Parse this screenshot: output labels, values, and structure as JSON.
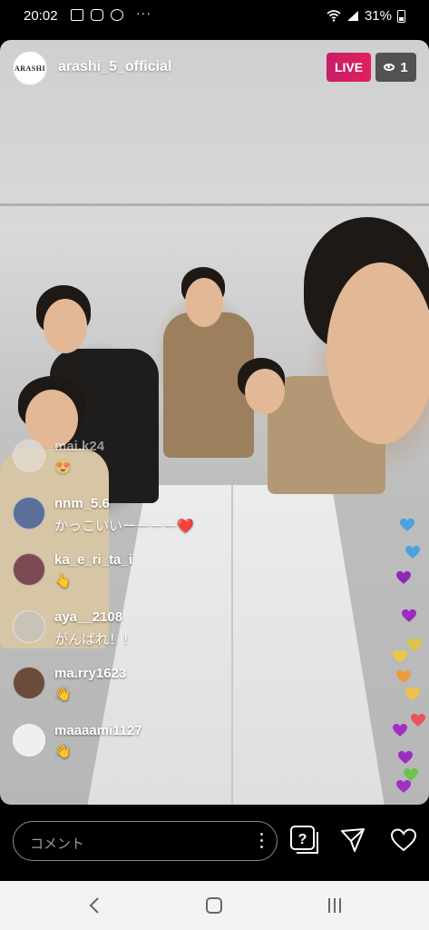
{
  "status_bar": {
    "time": "20:02",
    "battery": "31%",
    "icons": [
      "gallery-icon",
      "line-icon",
      "app-icon",
      "more-dots-icon",
      "wifi-icon",
      "signal-icon",
      "battery-icon"
    ]
  },
  "header": {
    "host_avatar_text": "ARASHI",
    "host_name": "arashi_5_official",
    "live_label": "LIVE",
    "viewer_count": "1"
  },
  "comments": [
    {
      "user": "mai.k24",
      "text": "😍",
      "avatar_color": "#e9e4df"
    },
    {
      "user": "nnm_5.6",
      "text": "かっこいいーーーー❤️",
      "avatar_color": "#5a6f9a"
    },
    {
      "user": "ka_e_ri_ta_i",
      "text": "👆",
      "avatar_color": "#7b4a52"
    },
    {
      "user": "aya__2108",
      "text": "がんばれ！！",
      "avatar_color": "#c9c2b6"
    },
    {
      "user": "ma.rry1623",
      "text": "👋",
      "avatar_color": "#6b4b3a"
    },
    {
      "user": "maaaami1127",
      "text": "👋",
      "avatar_color": "#efefef"
    }
  ],
  "hearts": [
    {
      "color": "#4aa3df"
    },
    {
      "color": "#4aa3df"
    },
    {
      "color": "#8e2bb5"
    },
    {
      "color": "#9a2ec0"
    },
    {
      "color": "#e0c34a"
    },
    {
      "color": "#e7c84b"
    },
    {
      "color": "#ef9a3c"
    },
    {
      "color": "#f2c04a"
    },
    {
      "color": "#e9545a"
    },
    {
      "color": "#a22fc4"
    },
    {
      "color": "#9a2ec0"
    },
    {
      "color": "#6cc44f"
    },
    {
      "color": "#a22fc4"
    }
  ],
  "bottom_bar": {
    "comment_placeholder": "コメント",
    "question_label": "?"
  },
  "colors": {
    "live": "#e2205a",
    "background": "#000000"
  }
}
